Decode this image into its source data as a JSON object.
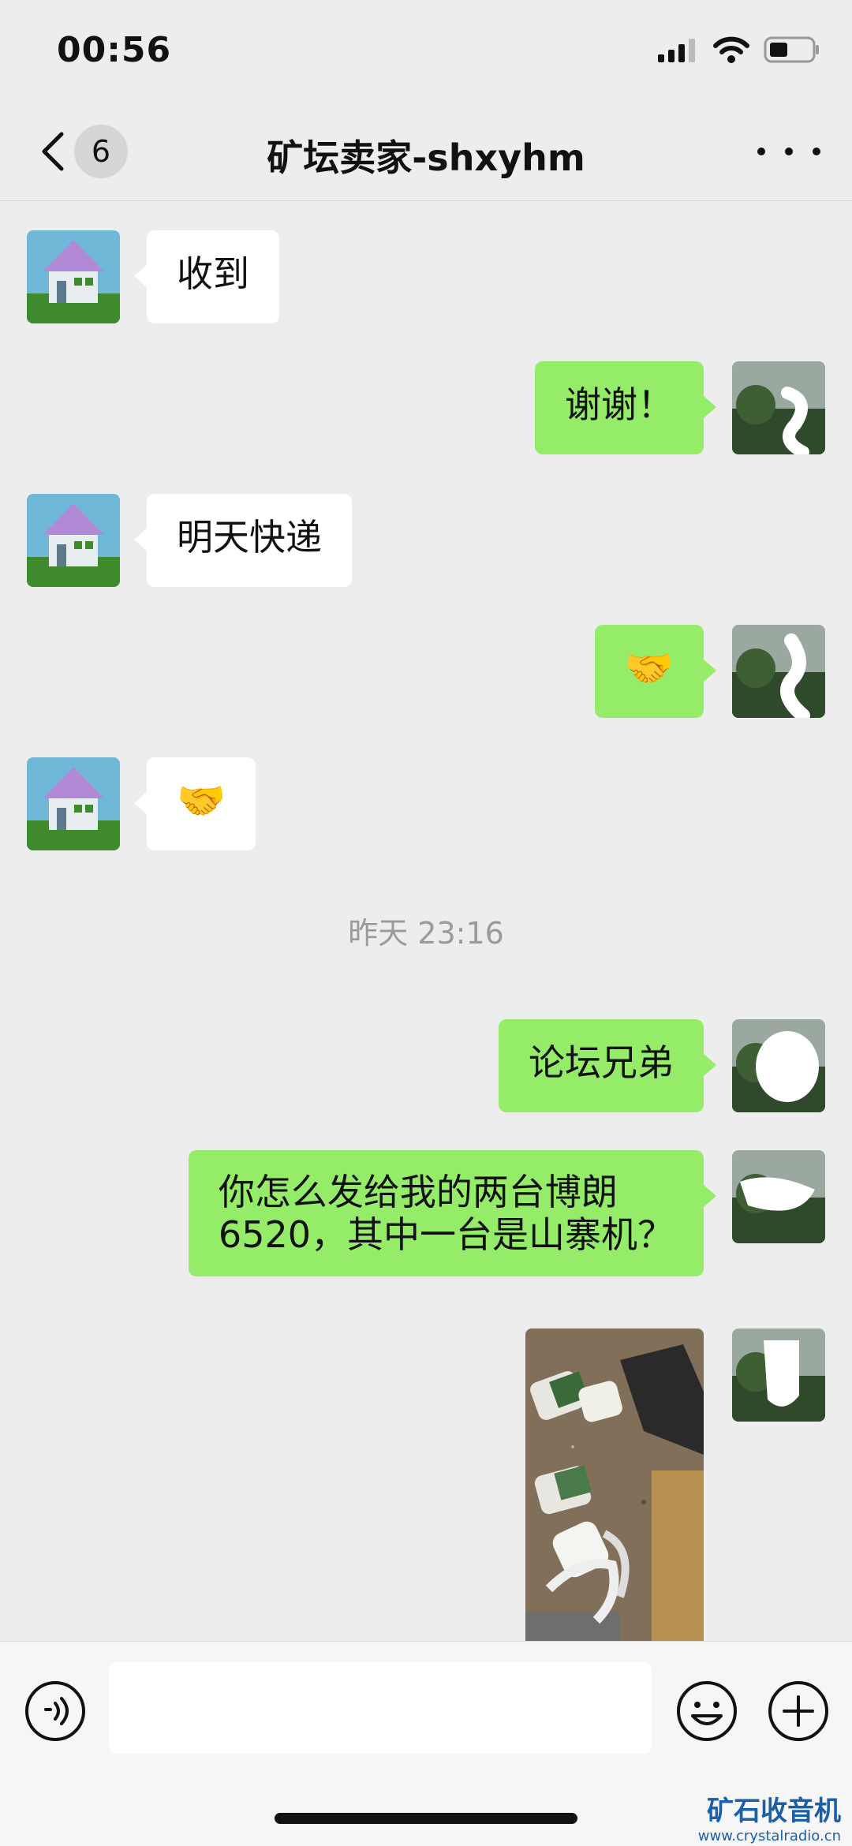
{
  "status_bar": {
    "time": "00:56"
  },
  "header": {
    "unread_count": "6",
    "title": "矿坛卖家-shxyhm"
  },
  "messages": [
    {
      "side": "in",
      "text": "收到"
    },
    {
      "side": "out",
      "text": "谢谢！"
    },
    {
      "side": "in",
      "text": "明天快递"
    },
    {
      "side": "out",
      "text": "🤝"
    },
    {
      "side": "in",
      "text": "🤝"
    },
    {
      "type": "time",
      "text": "昨天 23:16"
    },
    {
      "side": "out",
      "text": "论坛兄弟"
    },
    {
      "side": "out",
      "text_line1": "你怎么发给我的两台博朗",
      "text_line2": "6520，其中一台是山寨机？"
    },
    {
      "side": "out",
      "type": "image"
    }
  ],
  "input": {
    "placeholder": ""
  },
  "watermark": {
    "title": "矿石收音机",
    "url": "www.crystalradio.cn"
  },
  "colors": {
    "background": "#ededed",
    "outgoing_bubble": "#95ec69",
    "incoming_bubble": "#ffffff"
  }
}
